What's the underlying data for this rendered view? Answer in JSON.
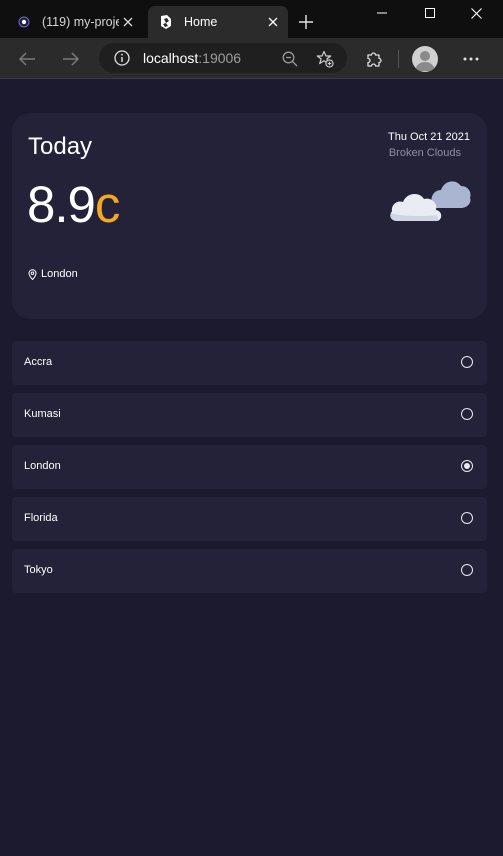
{
  "browser": {
    "tabs": [
      {
        "title": "(119) my-proje",
        "active": false,
        "favicon": "dot-favicon-icon"
      },
      {
        "title": "Home",
        "active": true,
        "favicon": "app-favicon-icon"
      }
    ],
    "url_host": "localhost",
    "url_port": ":19006"
  },
  "weather": {
    "heading": "Today",
    "temperature": "8.9",
    "unit": "c",
    "date": "Thu Oct 21 2021",
    "condition": "Broken Clouds",
    "location": "London",
    "icon": "broken-clouds-icon"
  },
  "cities": [
    {
      "name": "Accra",
      "selected": false
    },
    {
      "name": "Kumasi",
      "selected": false
    },
    {
      "name": "London",
      "selected": true
    },
    {
      "name": "Florida",
      "selected": false
    },
    {
      "name": "Tokyo",
      "selected": false
    }
  ],
  "colors": {
    "background": "#1b1a2e",
    "card": "#232238",
    "accent": "#f5a623",
    "muted_text": "#8f8fa3"
  }
}
